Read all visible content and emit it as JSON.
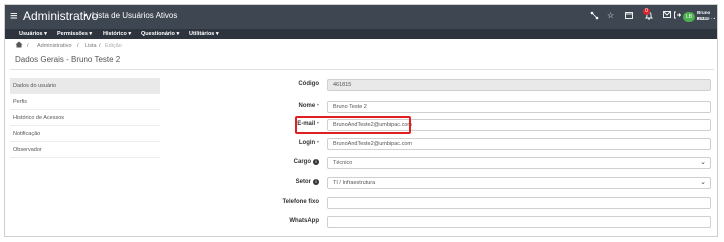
{
  "header": {
    "menu_icon": "hamburger-icon",
    "app_title": "Administrativo",
    "breadcrumb_separator": "▸",
    "page_title": "Lista de Usuários Ativos",
    "icons": [
      "grid-share-icon",
      "star-icon",
      "calendar-icon",
      "bell-icon",
      "mail-icon",
      "logout-icon"
    ],
    "notification_count": "0",
    "user": {
      "initials": "LB",
      "name": "Bruno Est...",
      "id": "#1299 - •"
    }
  },
  "menu": [
    {
      "label": "Usuários"
    },
    {
      "label": "Permissões"
    },
    {
      "label": "Histórico"
    },
    {
      "label": "Questionário"
    },
    {
      "label": "Utilitários"
    }
  ],
  "breadcrumb": {
    "home_icon": "home-icon",
    "items": [
      "Administrativo",
      "Lista",
      "Edição"
    ]
  },
  "section_title": "Dados Gerais - Bruno Teste 2",
  "sidebar": {
    "items": [
      {
        "label": "Dados do usuário",
        "active": true
      },
      {
        "label": "Perfis"
      },
      {
        "label": "Histórico de Acessos"
      },
      {
        "label": "Notificação"
      },
      {
        "label": "Observador"
      }
    ]
  },
  "form": {
    "codigo": {
      "label": "Código",
      "value": "461815"
    },
    "nome": {
      "label": "Nome",
      "required": "•",
      "value": "Bruno Teste 2"
    },
    "email": {
      "label": "E-mail",
      "required": "•",
      "value": "BrunoAndTeste2@umbipac.com"
    },
    "login": {
      "label": "Login",
      "required": "•",
      "value": "BrunoAndTeste2@umbipac.com"
    },
    "cargo": {
      "label": "Cargo",
      "value": "Técnico"
    },
    "setor": {
      "label": "Setor",
      "value": "TI / Infraestrutura"
    },
    "telefone": {
      "label": "Telefone fixo",
      "value": ""
    },
    "whatsapp": {
      "label": "WhatsApp",
      "value": ""
    }
  },
  "colors": {
    "header_bg": "#3d4651",
    "menu_bg": "#2d343d",
    "highlight": "#e02020",
    "avatar": "#4caf50",
    "badge": "#d9272e"
  }
}
